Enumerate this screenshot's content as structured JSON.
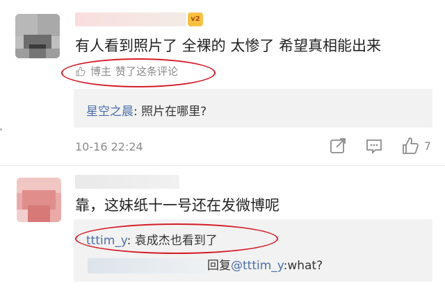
{
  "comments": [
    {
      "vip_badge": "v2",
      "text": "有人看到照片了 全裸的 太惨了 希望真相能出来",
      "like_note": {
        "author": "博主",
        "action": "赞了这条评论"
      },
      "reply": {
        "user": "星空之晨",
        "sep": ": ",
        "text": "照片在哪里?"
      },
      "time": "10-16 22:24",
      "like_count": "7"
    },
    {
      "text": "靠，这妹纸十一号还在发微博呢",
      "replies": [
        {
          "user": "tttim_y",
          "sep": ": ",
          "text": "袁成杰也看到了"
        },
        {
          "prefix": "回复",
          "mention": "@tttim_y",
          "text": ":what?"
        }
      ]
    }
  ],
  "colors": {
    "link": "#4a6ea9",
    "annotation": "#d41b26",
    "meta": "#8a8a8a",
    "reply_bg": "#f2f2f2"
  },
  "icons": [
    "thumb-up-icon",
    "share-icon",
    "comment-icon"
  ]
}
